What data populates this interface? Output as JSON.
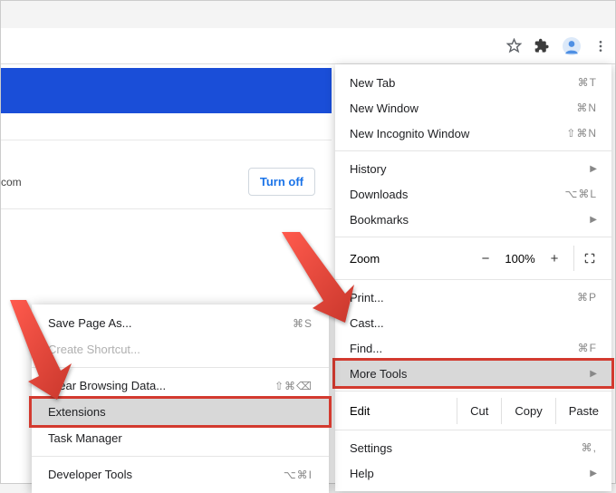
{
  "toolbar": {
    "star_icon": "star",
    "puzzle_icon": "extensions",
    "profile_icon": "profile",
    "menu_icon": "more"
  },
  "page": {
    "row_text": "com",
    "turn_off": "Turn off"
  },
  "menu": {
    "new_tab": "New Tab",
    "new_tab_sc": "⌘T",
    "new_window": "New Window",
    "new_window_sc": "⌘N",
    "incognito": "New Incognito Window",
    "incognito_sc": "⇧⌘N",
    "history": "History",
    "downloads": "Downloads",
    "downloads_sc": "⌥⌘L",
    "bookmarks": "Bookmarks",
    "zoom": "Zoom",
    "zoom_pct": "100%",
    "print": "Print...",
    "print_sc": "⌘P",
    "cast": "Cast...",
    "find": "Find...",
    "find_sc": "⌘F",
    "more_tools": "More Tools",
    "edit": "Edit",
    "cut": "Cut",
    "copy": "Copy",
    "paste": "Paste",
    "settings": "Settings",
    "settings_sc": "⌘,",
    "help": "Help"
  },
  "submenu": {
    "save_as": "Save Page As...",
    "save_as_sc": "⌘S",
    "create_shortcut": "Create Shortcut...",
    "clear_data": "Clear Browsing Data...",
    "clear_data_sc": "⇧⌘⌫",
    "extensions": "Extensions",
    "task_manager": "Task Manager",
    "dev_tools": "Developer Tools",
    "dev_tools_sc": "⌥⌘I"
  }
}
